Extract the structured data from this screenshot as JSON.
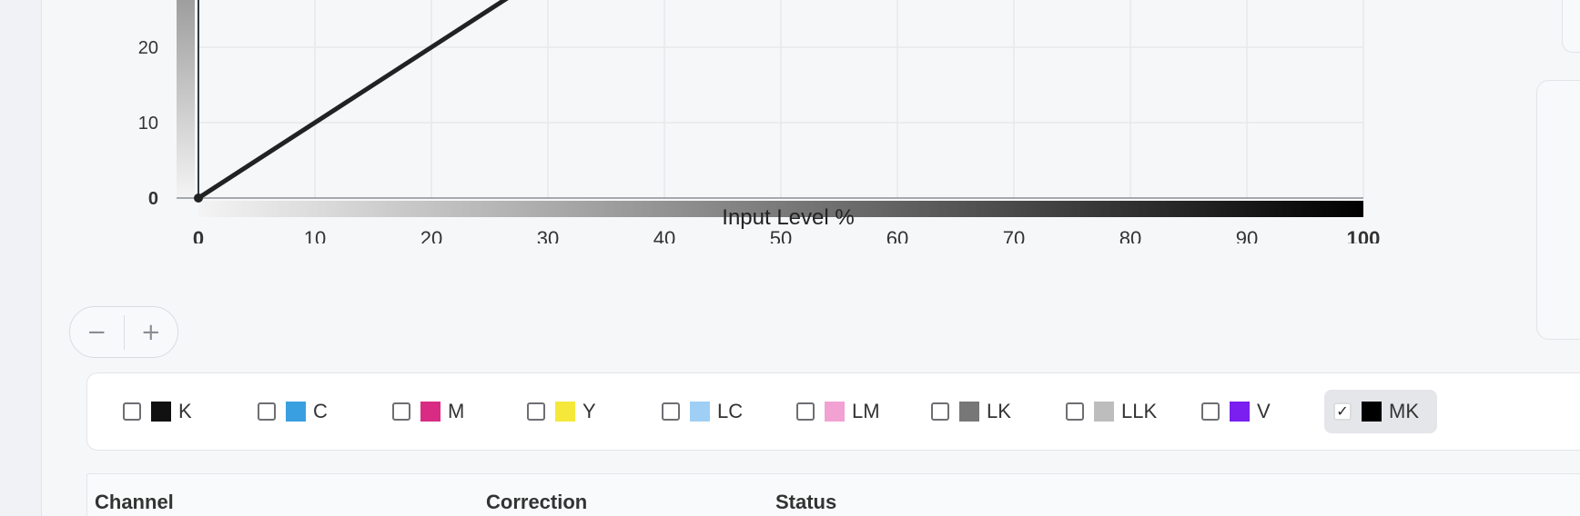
{
  "chart_data": {
    "type": "line",
    "xlabel": "Input Level %",
    "ylabel": "",
    "xlim": [
      0,
      100
    ],
    "ylim": [
      0,
      100
    ],
    "x_ticks": [
      "0",
      "10",
      "20",
      "30",
      "40",
      "50",
      "60",
      "70",
      "80",
      "90",
      "100"
    ],
    "y_ticks": [
      "0",
      "10",
      "20"
    ],
    "grid": true,
    "series": [
      {
        "x": [
          0,
          100
        ],
        "y": [
          0,
          100
        ],
        "color": "#222222"
      }
    ]
  },
  "zoom": {
    "minus": "−",
    "plus": "+"
  },
  "channels": [
    {
      "label": "K",
      "color": "#111111",
      "checked": false
    },
    {
      "label": "C",
      "color": "#3a9fe0",
      "checked": false
    },
    {
      "label": "M",
      "color": "#d92b84",
      "checked": false
    },
    {
      "label": "Y",
      "color": "#f5e83a",
      "checked": false
    },
    {
      "label": "LC",
      "color": "#9fcff5",
      "checked": false
    },
    {
      "label": "LM",
      "color": "#f2a1d3",
      "checked": false
    },
    {
      "label": "LK",
      "color": "#777777",
      "checked": false
    },
    {
      "label": "LLK",
      "color": "#bdbdbd",
      "checked": false
    },
    {
      "label": "V",
      "color": "#7a1ff0",
      "checked": false
    },
    {
      "label": "MK",
      "color": "#000000",
      "checked": true,
      "check_mark": "✓"
    }
  ],
  "table": {
    "headers": [
      "Channel",
      "Correction",
      "Status"
    ]
  }
}
